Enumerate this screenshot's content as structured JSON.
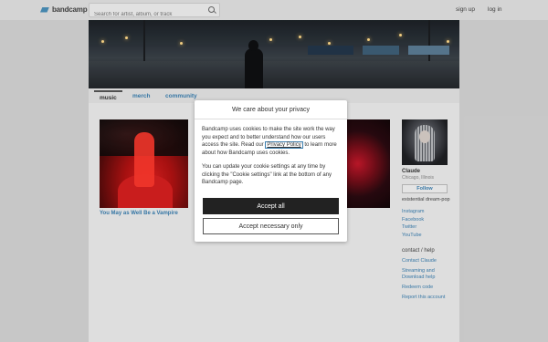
{
  "header": {
    "logo_text": "bandcamp",
    "search_placeholder": "Search for artist, album, or track",
    "signup": "sign up",
    "login": "log in"
  },
  "nav": {
    "tabs": [
      {
        "label": "music",
        "active": true
      },
      {
        "label": "merch",
        "active": false
      },
      {
        "label": "community",
        "active": false
      }
    ]
  },
  "album": {
    "title": "You May as Well Be a Vampire"
  },
  "artist": {
    "name": "Claude",
    "location": "Chicago, Illinois",
    "follow_label": "Follow",
    "bio": "existential dream-pop",
    "links": [
      "Instagram",
      "Facebook",
      "Twitter",
      "YouTube"
    ],
    "contact_heading": "contact / help",
    "contact_links": [
      "Contact Claude",
      "Streaming and Download help",
      "Redeem code",
      "Report this account"
    ]
  },
  "privacy_dialog": {
    "title": "We care about your privacy",
    "para1_before": "Bandcamp uses cookies to make the site work the way you expect and to better understand how our users access the site. Read our ",
    "para1_link": "Privacy Policy",
    "para1_after": " to learn more about how Bandcamp uses cookies.",
    "para2": "You can update your cookie settings at any time by clicking the \"Cookie settings\" link at the bottom of any Bandcamp page.",
    "accept_all": "Accept all",
    "accept_necessary": "Accept necessary only"
  },
  "colors": {
    "link_blue": "#3b7fb0",
    "button_dark": "#222222",
    "logo_blue": "#4a8fb8"
  }
}
